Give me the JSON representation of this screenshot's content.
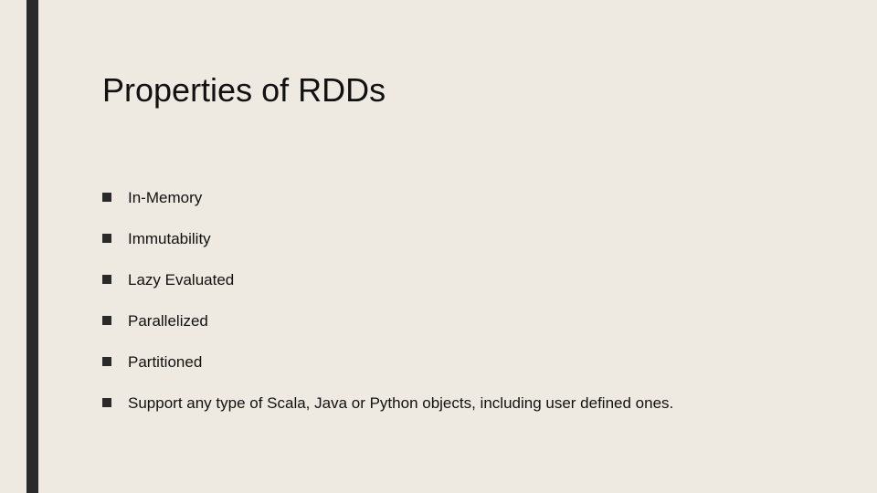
{
  "slide": {
    "title": "Properties of RDDs",
    "bullets": [
      "In-Memory",
      "Immutability",
      "Lazy Evaluated",
      "Parallelized",
      "Partitioned",
      "Support any type of Scala, Java or Python objects, including user defined ones."
    ]
  }
}
